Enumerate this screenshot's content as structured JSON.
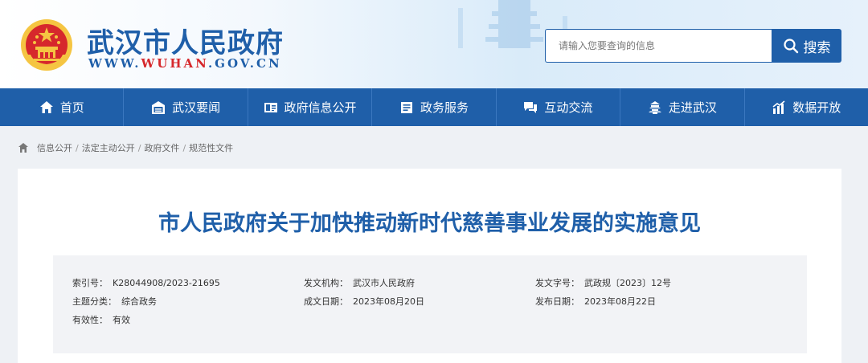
{
  "header": {
    "site_title": "武汉市人民政府",
    "url_prefix": "WWW.",
    "url_accent": "WUHAN",
    "url_suffix": ".GOV.CN",
    "search_placeholder": "请输入您要查询的信息",
    "search_label": "搜索"
  },
  "nav": {
    "items": [
      {
        "label": "首页",
        "icon": "home-icon"
      },
      {
        "label": "武汉要闻",
        "icon": "news-icon"
      },
      {
        "label": "政府信息公开",
        "icon": "info-card-icon"
      },
      {
        "label": "政务服务",
        "icon": "service-icon"
      },
      {
        "label": "互动交流",
        "icon": "chat-icon"
      },
      {
        "label": "走进武汉",
        "icon": "landmark-icon"
      },
      {
        "label": "数据开放",
        "icon": "data-chart-icon"
      }
    ]
  },
  "breadcrumb": {
    "items": [
      "信息公开",
      "法定主动公开",
      "政府文件",
      "规范性文件"
    ],
    "separator": "/"
  },
  "document": {
    "title": "市人民政府关于加快推动新时代慈善事业发展的实施意见",
    "meta": {
      "index_label": "索引号：",
      "index_value": "K28044908/2023-21695",
      "issuer_label": "发文机构：",
      "issuer_value": "武汉市人民政府",
      "doc_no_label": "发文字号：",
      "doc_no_value": "武政规〔2023〕12号",
      "category_label": "主题分类：",
      "category_value": "综合政务",
      "written_label": "成文日期：",
      "written_value": "2023年08月20日",
      "published_label": "发布日期：",
      "published_value": "2023年08月22日",
      "validity_label": "有效性：",
      "validity_value": "有效"
    }
  },
  "colors": {
    "brand_blue": "#1f5fa9",
    "emblem_red": "#d6282c",
    "emblem_gold": "#f5c542"
  }
}
